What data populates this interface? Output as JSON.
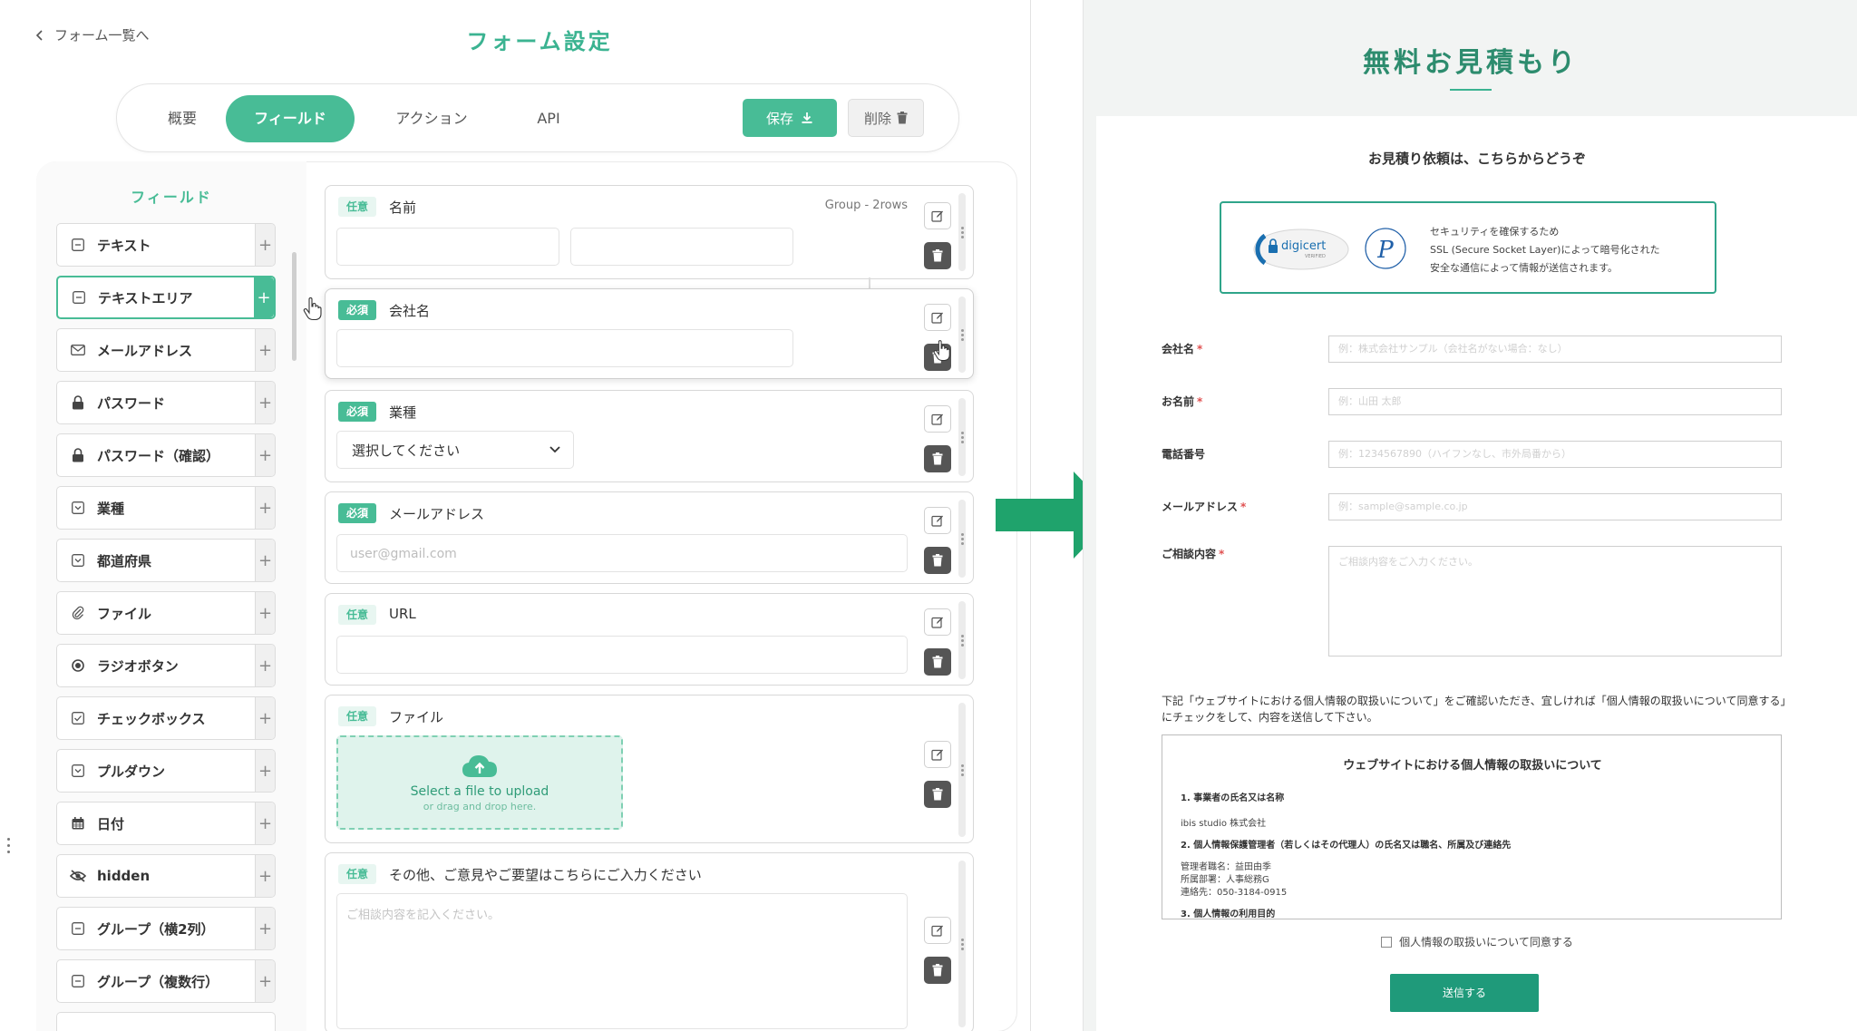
{
  "left": {
    "back_label": "フォーム一覧へ",
    "title": "フォーム設定",
    "tabs": [
      {
        "label": "概要"
      },
      {
        "label": "フィールド"
      },
      {
        "label": "アクション"
      },
      {
        "label": "API"
      }
    ],
    "save_label": "保存",
    "delete_label": "削除",
    "palette_title": "フィールド",
    "palette_items": [
      {
        "label": "テキスト",
        "icon": "text-field-icon"
      },
      {
        "label": "テキストエリア",
        "icon": "textarea-icon"
      },
      {
        "label": "メールアドレス",
        "icon": "mail-icon"
      },
      {
        "label": "パスワード",
        "icon": "lock-icon"
      },
      {
        "label": "パスワード（確認）",
        "icon": "lock-icon"
      },
      {
        "label": "業種",
        "icon": "select-icon"
      },
      {
        "label": "都道府県",
        "icon": "select-icon"
      },
      {
        "label": "ファイル",
        "icon": "paperclip-icon"
      },
      {
        "label": "ラジオボタン",
        "icon": "radio-icon"
      },
      {
        "label": "チェックボックス",
        "icon": "checkbox-icon"
      },
      {
        "label": "プルダウン",
        "icon": "select-icon"
      },
      {
        "label": "日付",
        "icon": "calendar-icon"
      },
      {
        "label": "hidden",
        "icon": "eye-slash-icon"
      },
      {
        "label": "グループ（横2列）",
        "icon": "group-icon"
      },
      {
        "label": "グループ（複数行）",
        "icon": "group-icon"
      }
    ],
    "plus": "+",
    "fields": [
      {
        "badge": "任意",
        "label": "名前",
        "note": "Group - 2rows"
      },
      {
        "badge": "必須",
        "label": "会社名"
      },
      {
        "badge": "必須",
        "label": "業種",
        "select_value": "選択してください"
      },
      {
        "badge": "必須",
        "label": "メールアドレス",
        "placeholder": "user@gmail.com"
      },
      {
        "badge": "任意",
        "label": "URL"
      },
      {
        "badge": "任意",
        "label": "ファイル",
        "upload_main": "Select a file to upload",
        "upload_sub": "or drag and drop here."
      },
      {
        "badge": "任意",
        "label": "その他、ご意見やご要望はこちらにご入力ください",
        "placeholder": "ご相談内容を記入ください。"
      }
    ]
  },
  "right": {
    "title": "無料お見積もり",
    "subtitle": "お見積り依頼は、こちらからどうぞ",
    "ssl_lines": [
      "セキュリティを確保するため",
      "SSL (Secure Socket Layer)によって暗号化された",
      "安全な通信によって情報が送信されます。"
    ],
    "digicert_word": "digicert",
    "digicert_sub": "VERIFIED",
    "fields": [
      {
        "label": "会社名",
        "required": "*",
        "placeholder": "例：株式会社サンプル（会社名がない場合：なし）"
      },
      {
        "label": "お名前",
        "required": "*",
        "placeholder": "例：山田 太郎"
      },
      {
        "label": "電話番号",
        "required": "",
        "placeholder": "例：1234567890（ハイフンなし、市外局番から）"
      },
      {
        "label": "メールアドレス",
        "required": "*",
        "placeholder": "例：sample@sample.co.jp"
      },
      {
        "label": "ご相談内容",
        "required": "*",
        "placeholder": "ご相談内容をご入力ください。"
      }
    ],
    "note": "下記「ウェブサイトにおける個人情報の取扱いについて」をご確認いただき、宜しければ「個人情報の取扱いについて同意する」にチェックをして、内容を送信して下さい。",
    "privacy": {
      "title": "ウェブサイトにおける個人情報の取扱いについて",
      "lines": [
        {
          "text": "1. 事業者の氏名又は名称",
          "bold": true
        },
        {
          "text": "ibis studio 株式会社",
          "bold": false
        },
        {
          "text": "2. 個人情報保護管理者（若しくはその代理人）の氏名又は職名、所属及び連絡先",
          "bold": true
        },
        {
          "text": "管理者職名：益田由季",
          "bold": false
        },
        {
          "text": "所属部署：人事総務G",
          "bold": false
        },
        {
          "text": "連絡先：050-3184-0915",
          "bold": false
        },
        {
          "text": "3. 個人情報の利用目的",
          "bold": true
        }
      ]
    },
    "agree_label": "個人情報の取扱いについて同意する",
    "submit_label": "送信する"
  },
  "colors": {
    "accent": "#48bc96",
    "accent_dark": "#2d8c6e",
    "arrow": "#1fa36c",
    "required": "#e05050"
  }
}
